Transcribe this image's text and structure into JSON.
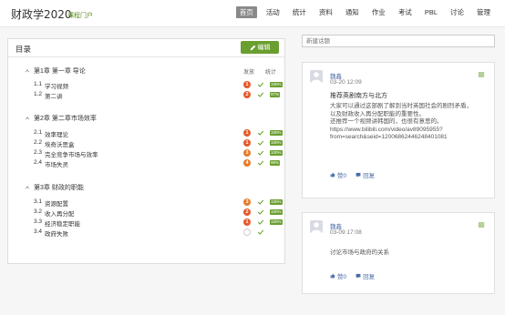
{
  "header": {
    "title": "财政学2020",
    "portal_link": "课程门户",
    "nav": [
      {
        "label": "首页",
        "active": true
      },
      {
        "label": "活动",
        "active": false
      },
      {
        "label": "统计",
        "active": false
      },
      {
        "label": "资料",
        "active": false
      },
      {
        "label": "通知",
        "active": false
      },
      {
        "label": "作业",
        "active": false
      },
      {
        "label": "考试",
        "active": false
      },
      {
        "label": "PBL",
        "active": false
      },
      {
        "label": "讨论",
        "active": false
      },
      {
        "label": "管理",
        "active": false
      }
    ]
  },
  "toc": {
    "title": "目录",
    "edit_label": "编辑",
    "col_publish": "发放",
    "col_stats": "统计",
    "chapters": [
      {
        "title": "第1章 第一章 导论",
        "items": [
          {
            "num": "1.1",
            "name": "学习视频",
            "badge": "1",
            "badge_color": "#e55a2b",
            "pct": "100%"
          },
          {
            "num": "1.2",
            "name": "第二讲",
            "badge": "2",
            "badge_color": "#e55a2b",
            "pct": "97%"
          }
        ]
      },
      {
        "title": "第2章 第二章市场效率",
        "items": [
          {
            "num": "2.1",
            "name": "效率理论",
            "badge": "1",
            "badge_color": "#e55a2b",
            "pct": "100%"
          },
          {
            "num": "2.2",
            "name": "埃奇沃思盒",
            "badge": "1",
            "badge_color": "#e55a2b",
            "pct": "100%"
          },
          {
            "num": "2.3",
            "name": "完全竞争市场与效率",
            "badge": "3",
            "badge_color": "#e57a2b",
            "pct": "100%"
          },
          {
            "num": "2.4",
            "name": "市场失灵",
            "badge": "4",
            "badge_color": "#e57a2b",
            "pct": "98%"
          }
        ]
      },
      {
        "title": "第3章 财政的职能",
        "items": [
          {
            "num": "3.1",
            "name": "资源配置",
            "badge": "3",
            "badge_color": "#e57a2b",
            "pct": "100%"
          },
          {
            "num": "3.2",
            "name": "收入再分配",
            "badge": "2",
            "badge_color": "#e55a2b",
            "pct": "100%"
          },
          {
            "num": "3.3",
            "name": "经济稳定职能",
            "badge": "1",
            "badge_color": "#e55a2b",
            "pct": "100%"
          },
          {
            "num": "3.4",
            "name": "政府失败",
            "badge": "",
            "badge_color": "",
            "pct": ""
          }
        ]
      }
    ]
  },
  "new_topic_placeholder": "新建话题",
  "posts": [
    {
      "user": "魏鑫",
      "date": "03-20 12:09",
      "title": "推荐英剧南方与北方",
      "body_lines": [
        "大家可以通过这部剧了解到当时英国社会的剧烈矛盾，",
        "以及财政收入再分配职能的重要性。",
        "还推荐一个视频讲韩国的，也很有意思的。",
        "https://www.bilibili.com/video/av89095955?",
        "from=search&seid=12006862446248401081"
      ],
      "like_label": "赞0",
      "reply_label": "回复"
    },
    {
      "user": "魏鑫",
      "date": "03-09 17:08",
      "title": "",
      "body_lines": [
        "讨论市场与政府的关系"
      ],
      "like_label": "赞0",
      "reply_label": "回复"
    }
  ],
  "colors": {
    "accent_green": "#6a9f2f",
    "badge_red": "#e55a2b",
    "badge_orange": "#e57a2b",
    "link_blue": "#4a6da7"
  }
}
